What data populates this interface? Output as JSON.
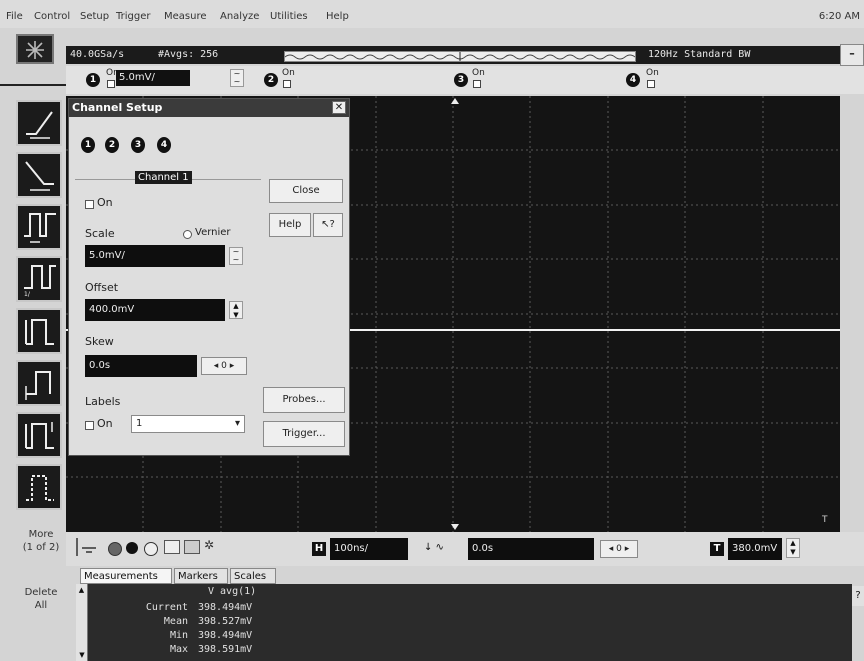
{
  "menubar": {
    "items": [
      "File",
      "Control",
      "Setup",
      "Trigger",
      "Measure",
      "Analyze",
      "Utilities",
      "Help"
    ],
    "clock": "6:20 AM"
  },
  "status": {
    "sample_rate": "40.0GSa/s",
    "averages": "#Avgs: 256",
    "bandwidth": "120Hz Standard BW"
  },
  "channel_row": {
    "ch1": {
      "num": "1",
      "on": "On",
      "scale": "5.0mV/"
    },
    "ch2": {
      "num": "2",
      "on": "On"
    },
    "ch3": {
      "num": "3",
      "on": "On"
    },
    "ch4": {
      "num": "4",
      "on": "On"
    }
  },
  "left_toolbar": {
    "more_label": "More",
    "more_page": "(1 of 2)",
    "delete_label": "Delete",
    "delete_all": "All"
  },
  "dialog": {
    "title": "Channel Setup",
    "channels": [
      "1",
      "2",
      "3",
      "4"
    ],
    "channel_label": "Channel 1",
    "on_label": "On",
    "scale_label": "Scale",
    "vernier_label": "Vernier",
    "scale_value": "5.0mV/",
    "offset_label": "Offset",
    "offset_value": "400.0mV",
    "skew_label": "Skew",
    "skew_value": "0.0s",
    "skew_zero": "0",
    "labels_label": "Labels",
    "labels_on": "On",
    "labels_value": "1",
    "close_btn": "Close",
    "help_btn": "Help",
    "probes_btn": "Probes...",
    "trigger_btn": "Trigger..."
  },
  "controls": {
    "h_label": "H",
    "h_value": "100ns/",
    "delay_value": "0.0s",
    "delay_zero": "0",
    "t_label": "T",
    "t_value": "380.0mV"
  },
  "tabs": [
    "Measurements",
    "Markers",
    "Scales"
  ],
  "measurements": {
    "header": "V avg(1)",
    "rows": [
      {
        "label": "Current",
        "value": "398.494mV"
      },
      {
        "label": "Mean",
        "value": "398.527mV"
      },
      {
        "label": "Min",
        "value": "398.494mV"
      },
      {
        "label": "Max",
        "value": "398.591mV"
      }
    ]
  },
  "colors": {
    "grid_bg": "#141414",
    "trace": "#f2f2f2",
    "dialog_bg": "#dedede"
  }
}
